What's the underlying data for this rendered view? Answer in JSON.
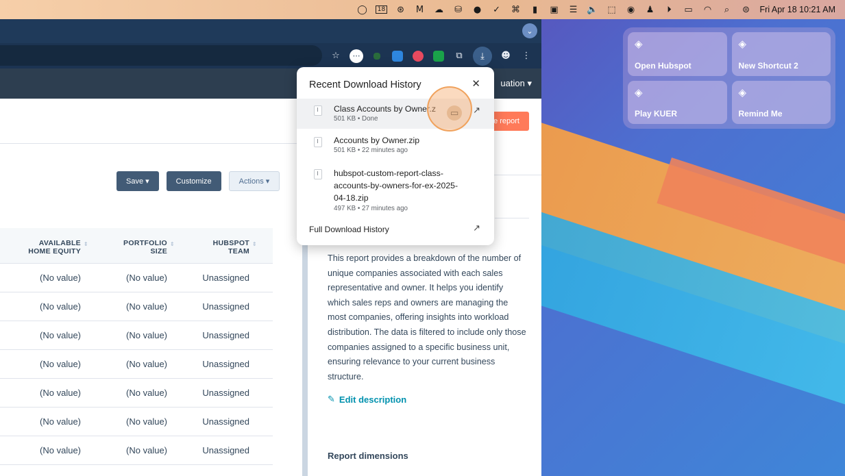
{
  "menubar": {
    "clock": "Fri Apr 18  10:21 AM",
    "calendar_day": "18"
  },
  "app_nav": {
    "account_label": "uation"
  },
  "toolbar_buttons": {
    "save": "Save",
    "customize": "Customize",
    "actions": "Actions"
  },
  "create_report_label": "e report",
  "grid": {
    "headers": [
      {
        "line1": "AVAILABLE",
        "line2": "HOME EQUITY"
      },
      {
        "line1": "PORTFOLIO",
        "line2": "SIZE"
      },
      {
        "line1": "HUBSPOT",
        "line2": "TEAM"
      }
    ],
    "rows": [
      [
        "(No value)",
        "(No value)",
        "Unassigned"
      ],
      [
        "(No value)",
        "(No value)",
        "Unassigned"
      ],
      [
        "(No value)",
        "(No value)",
        "Unassigned"
      ],
      [
        "(No value)",
        "(No value)",
        "Unassigned"
      ],
      [
        "(No value)",
        "(No value)",
        "Unassigned"
      ],
      [
        "(No value)",
        "(No value)",
        "Unassigned"
      ],
      [
        "(No value)",
        "(No value)",
        "Unassigned"
      ]
    ]
  },
  "report_panel": {
    "description": "This report provides a breakdown of the number of unique companies associated with each sales representative and owner. It helps you identify which sales reps and owners are managing the most companies, offering insights into workload distribution. The data is filtered to include only those companies assigned to a specific business unit, ensuring relevance to your current business structure.",
    "edit_description": "Edit description",
    "dimensions_title": "Report dimensions"
  },
  "download_popup": {
    "title": "Recent Download History",
    "items": [
      {
        "name": "Class Accounts by Owner.z",
        "meta": "501 KB • Done"
      },
      {
        "name": "Accounts by Owner.zip",
        "meta": "501 KB • 22 minutes ago"
      },
      {
        "name": "hubspot-custom-report-class-accounts-by-owners-for-ex-2025-04-18.zip",
        "meta": "497 KB • 27 minutes ago"
      }
    ],
    "full_history": "Full Download History"
  },
  "shortcuts": [
    {
      "label": "Open Hubspot"
    },
    {
      "label": "New Shortcut 2"
    },
    {
      "label": "Play KUER"
    },
    {
      "label": "Remind Me"
    }
  ]
}
